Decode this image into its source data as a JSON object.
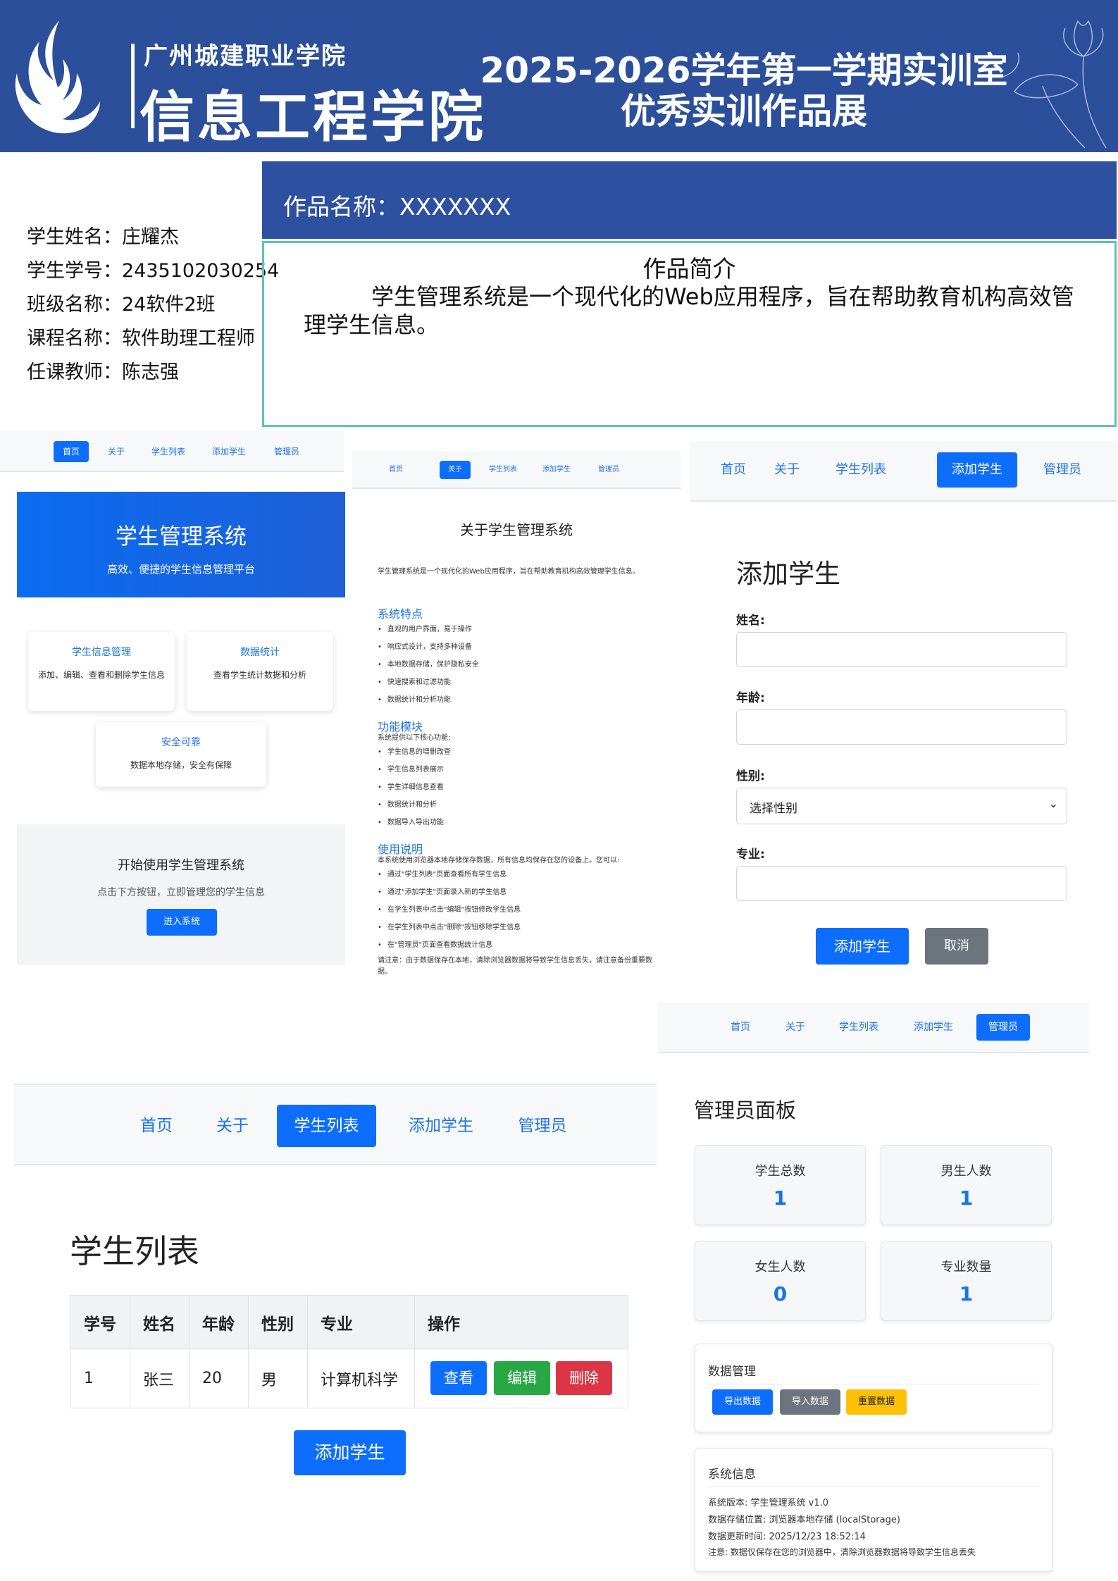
{
  "header": {
    "school_name": "广州城建职业学院",
    "college_name": "信息工程学院",
    "title_line1": "2025-2026学年第一学期实训室",
    "title_line2": "优秀实训作品展",
    "brand_color": "#2b4f9a"
  },
  "student_info": {
    "name": "学生姓名：庄耀杰",
    "id": "学生学号：2435102030254",
    "class": "班级名称：24软件2班",
    "course": "课程名称：软件助理工程师",
    "teacher": "任课教师：陈志强"
  },
  "work": {
    "name": "作品名称：XXXXXXX",
    "intro_title": "作品简介",
    "intro_text": "学生管理系统是一个现代化的Web应用程序，旨在帮助教育机构高效管理学生信息。"
  },
  "nav": {
    "home": "首页",
    "about": "关于",
    "list": "学生列表",
    "add": "添加学生",
    "admin": "管理员"
  },
  "home_page": {
    "hero_title": "学生管理系统",
    "hero_subtitle": "高效、便捷的学生信息管理平台",
    "cards": [
      {
        "title": "学生信息管理",
        "desc": "添加、编辑、查看和删除学生信息"
      },
      {
        "title": "数据统计",
        "desc": "查看学生统计数据和分析"
      },
      {
        "title": "安全可靠",
        "desc": "数据本地存储，安全有保障"
      }
    ],
    "cta_title": "开始使用学生管理系统",
    "cta_desc": "点击下方按钮，立即管理您的学生信息",
    "cta_button": "进入系统"
  },
  "about_page": {
    "title": "关于学生管理系统",
    "intro": "学生管理系统是一个现代化的Web应用程序，旨在帮助教育机构高效管理学生信息。",
    "features_heading": "系统特点",
    "features": [
      "直观的用户界面，易于操作",
      "响应式设计，支持多种设备",
      "本地数据存储，保护隐私安全",
      "快速搜索和过滤功能",
      "数据统计和分析功能"
    ],
    "modules_heading": "功能模块",
    "modules_intro": "系统提供以下核心功能:",
    "modules": [
      "学生信息的增删改查",
      "学生信息列表展示",
      "学生详细信息查看",
      "数据统计和分析",
      "数据导入导出功能"
    ],
    "usage_heading": "使用说明",
    "usage_intro": "本系统使用浏览器本地存储保存数据，所有信息均保存在您的设备上。您可以:",
    "usage": [
      "通过\"学生列表\"页面查看所有学生信息",
      "通过\"添加学生\"页面录入新的学生信息",
      "在学生列表中点击\"编辑\"按钮修改学生信息",
      "在学生列表中点击\"删除\"按钮移除学生信息",
      "在\"管理员\"页面查看数据统计信息"
    ],
    "note": "请注意：由于数据保存在本地，清除浏览器数据将导致学生信息丢失，请注意备份重要数据。"
  },
  "add_page": {
    "title": "添加学生",
    "name_label": "姓名:",
    "age_label": "年龄:",
    "gender_label": "性别:",
    "gender_selected": "选择性别",
    "major_label": "专业:",
    "submit_button": "添加学生",
    "cancel_button": "取消"
  },
  "list_page": {
    "title": "学生列表",
    "columns": [
      "学号",
      "姓名",
      "年龄",
      "性别",
      "专业",
      "操作"
    ],
    "rows": [
      {
        "id": "1",
        "name": "张三",
        "age": "20",
        "gender": "男",
        "major": "计算机科学"
      }
    ],
    "view_button": "查看",
    "edit_button": "编辑",
    "delete_button": "删除",
    "add_button": "添加学生"
  },
  "admin_page": {
    "title": "管理员面板",
    "stats": [
      {
        "label": "学生总数",
        "value": "1"
      },
      {
        "label": "男生人数",
        "value": "1"
      },
      {
        "label": "女生人数",
        "value": "0"
      },
      {
        "label": "专业数量",
        "value": "1"
      }
    ],
    "data_mgmt_title": "数据管理",
    "export_button": "导出数据",
    "import_button": "导入数据",
    "reset_button": "重置数据",
    "sys_info_title": "系统信息",
    "sys_version": "系统版本: 学生管理系统 v1.0",
    "storage": "数据存储位置: 浏览器本地存储 (localStorage)",
    "updated": "数据更新时间: 2025/12/23 18:52:14",
    "note": "注意: 数据仅保存在您的浏览器中，清除浏览器数据将导致学生信息丢失"
  }
}
